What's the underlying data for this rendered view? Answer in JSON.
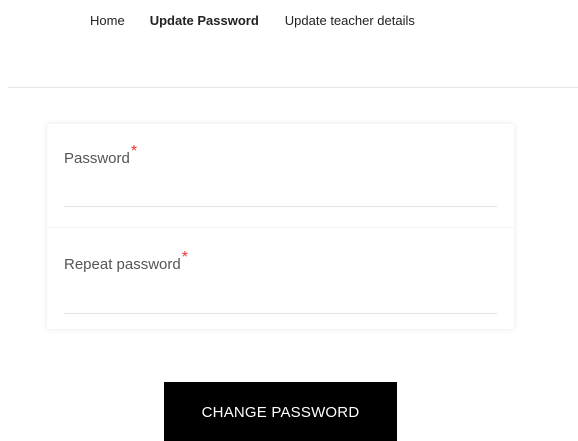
{
  "nav": {
    "items": [
      {
        "label": "Home"
      },
      {
        "label": "Update Password",
        "active": true
      },
      {
        "label": "Update teacher details"
      }
    ]
  },
  "form": {
    "fields": [
      {
        "label": "Password",
        "required_marker": "*",
        "value": ""
      },
      {
        "label": "Repeat password",
        "required_marker": "*",
        "value": ""
      }
    ],
    "submit_label": "CHANGE PASSWORD"
  },
  "colors": {
    "required": "#e53935",
    "button_bg": "#000000",
    "button_text": "#ffffff"
  }
}
